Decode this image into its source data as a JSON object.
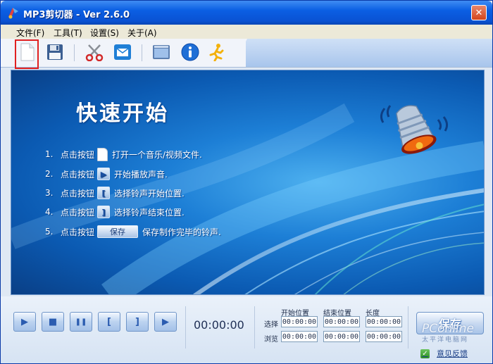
{
  "window": {
    "title": "MP3剪切器 - Ver 2.6.0",
    "close_glyph": "✕"
  },
  "menu": [
    {
      "label": "文件(F)"
    },
    {
      "label": "工具(T)"
    },
    {
      "label": "设置(S)"
    },
    {
      "label": "关于(A)"
    }
  ],
  "toolbar": {
    "icons": [
      "new-file-icon",
      "save-disk-icon",
      "scissors-icon",
      "mail-icon",
      "window-icon",
      "info-icon",
      "running-man-icon"
    ]
  },
  "quick_start": {
    "title": "快速开始",
    "steps": [
      {
        "num": "1.",
        "label": "点击按钮",
        "desc": "打开一个音乐/视频文件."
      },
      {
        "num": "2.",
        "label": "点击按钮",
        "desc": "开始播放声音."
      },
      {
        "num": "3.",
        "label": "点击按钮",
        "desc": "选择铃声开始位置."
      },
      {
        "num": "4.",
        "label": "点击按钮",
        "desc": "选择铃声结束位置."
      },
      {
        "num": "5.",
        "label": "点击按钮",
        "desc": "保存制作完毕的铃声."
      }
    ],
    "step2_glyph": "▶",
    "step3_glyph": "[",
    "step4_glyph": "]",
    "step5_button": "保存"
  },
  "controls": {
    "play_glyph": "▶",
    "stop_glyph": "■",
    "pause_glyph": "❚❚",
    "mark_start_glyph": "[",
    "mark_end_glyph": "]",
    "play_selection_glyph": "▶"
  },
  "timer": "00:00:00",
  "positions": {
    "headers": [
      "开始位置",
      "结束位置",
      "长度"
    ],
    "rows": [
      {
        "label": "选择",
        "values": [
          "00:00:00",
          "00:00:00",
          "00:00:00"
        ]
      },
      {
        "label": "浏览",
        "values": [
          "00:00:00",
          "00:00:00",
          "00:00:00"
        ]
      }
    ]
  },
  "save_button": "保存",
  "watermark": {
    "main": "PConline",
    "sub": "太平洋电脑网"
  },
  "feedback": {
    "label": "意见反馈",
    "check_glyph": "✓"
  }
}
